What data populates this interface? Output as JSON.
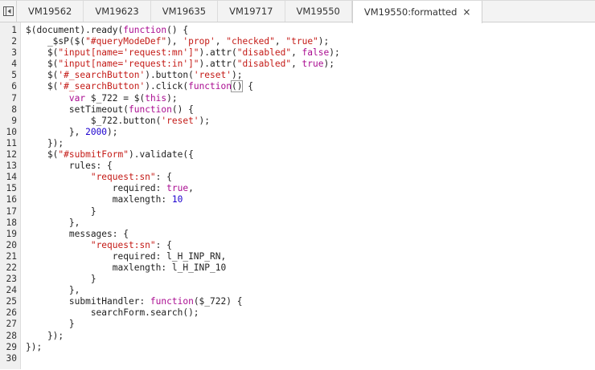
{
  "tabs": [
    {
      "label": "VM19562",
      "active": false
    },
    {
      "label": "VM19623",
      "active": false
    },
    {
      "label": "VM19635",
      "active": false
    },
    {
      "label": "VM19717",
      "active": false
    },
    {
      "label": "VM19550",
      "active": false
    },
    {
      "label": "VM19550:formatted",
      "active": true,
      "close": "×"
    }
  ],
  "icons": {
    "toggle_navigator": "toggle-navigator-icon",
    "close": "close-icon"
  },
  "colors": {
    "keyword": "#aa0d91",
    "string": "#c41a16",
    "number": "#1c00cf",
    "text": "#222222"
  },
  "code_lines": [
    [
      [
        "p",
        "$(document).ready("
      ],
      [
        "k",
        "function"
      ],
      [
        "p",
        "() {"
      ]
    ],
    [
      [
        "p",
        "    _$sP($("
      ],
      [
        "s",
        "\"#queryModeDef\""
      ],
      [
        "p",
        "), "
      ],
      [
        "s",
        "'prop'"
      ],
      [
        "p",
        ", "
      ],
      [
        "s",
        "\"checked\""
      ],
      [
        "p",
        ", "
      ],
      [
        "s",
        "\"true\""
      ],
      [
        "p",
        ");"
      ]
    ],
    [
      [
        "p",
        "    $("
      ],
      [
        "s",
        "\"input[name='request:mn']\""
      ],
      [
        "p",
        ").attr("
      ],
      [
        "s",
        "\"disabled\""
      ],
      [
        "p",
        ", "
      ],
      [
        "k",
        "false"
      ],
      [
        "p",
        ");"
      ]
    ],
    [
      [
        "p",
        "    $("
      ],
      [
        "s",
        "\"input[name='request:in']\""
      ],
      [
        "p",
        ").attr("
      ],
      [
        "s",
        "\"disabled\""
      ],
      [
        "p",
        ", "
      ],
      [
        "k",
        "true"
      ],
      [
        "p",
        ");"
      ]
    ],
    [
      [
        "p",
        "    $("
      ],
      [
        "s",
        "'#_searchButton'"
      ],
      [
        "p",
        ").button("
      ],
      [
        "s",
        "'reset'"
      ],
      [
        "p",
        ");"
      ]
    ],
    [
      [
        "p",
        "    $("
      ],
      [
        "s",
        "'#_searchButton'"
      ],
      [
        "p",
        ").click("
      ],
      [
        "k",
        "function"
      ],
      [
        "b",
        "()"
      ],
      [
        "p",
        " {"
      ]
    ],
    [
      [
        "p",
        "        "
      ],
      [
        "k",
        "var"
      ],
      [
        "p",
        " $_722 = $("
      ],
      [
        "k",
        "this"
      ],
      [
        "p",
        ");"
      ]
    ],
    [
      [
        "p",
        "        setTimeout("
      ],
      [
        "k",
        "function"
      ],
      [
        "p",
        "() {"
      ]
    ],
    [
      [
        "p",
        "            $_722.button("
      ],
      [
        "s",
        "'reset'"
      ],
      [
        "p",
        ");"
      ]
    ],
    [
      [
        "p",
        "        }, "
      ],
      [
        "n",
        "2000"
      ],
      [
        "p",
        ");"
      ]
    ],
    [
      [
        "p",
        "    });"
      ]
    ],
    [
      [
        "p",
        "    $("
      ],
      [
        "s",
        "\"#submitForm\""
      ],
      [
        "p",
        ").validate({"
      ]
    ],
    [
      [
        "p",
        "        rules: {"
      ]
    ],
    [
      [
        "p",
        "            "
      ],
      [
        "s",
        "\"request:sn\""
      ],
      [
        "p",
        ": {"
      ]
    ],
    [
      [
        "p",
        "                required: "
      ],
      [
        "k",
        "true"
      ],
      [
        "p",
        ","
      ]
    ],
    [
      [
        "p",
        "                maxlength: "
      ],
      [
        "n",
        "10"
      ]
    ],
    [
      [
        "p",
        "            }"
      ]
    ],
    [
      [
        "p",
        "        },"
      ]
    ],
    [
      [
        "p",
        "        messages: {"
      ]
    ],
    [
      [
        "p",
        "            "
      ],
      [
        "s",
        "\"request:sn\""
      ],
      [
        "p",
        ": {"
      ]
    ],
    [
      [
        "p",
        "                required: l_H_INP_RN,"
      ]
    ],
    [
      [
        "p",
        "                maxlength: l_H_INP_10"
      ]
    ],
    [
      [
        "p",
        "            }"
      ]
    ],
    [
      [
        "p",
        "        },"
      ]
    ],
    [
      [
        "p",
        "        submitHandler: "
      ],
      [
        "k",
        "function"
      ],
      [
        "p",
        "($_722) {"
      ]
    ],
    [
      [
        "p",
        "            searchForm.search();"
      ]
    ],
    [
      [
        "p",
        "        }"
      ]
    ],
    [
      [
        "p",
        "    });"
      ]
    ],
    [
      [
        "p",
        "});"
      ]
    ],
    []
  ],
  "line_numbers": [
    "1",
    "2",
    "3",
    "4",
    "5",
    "6",
    "7",
    "8",
    "9",
    "10",
    "11",
    "12",
    "13",
    "14",
    "15",
    "16",
    "17",
    "18",
    "19",
    "20",
    "21",
    "22",
    "23",
    "24",
    "25",
    "26",
    "27",
    "28",
    "29",
    "30"
  ]
}
